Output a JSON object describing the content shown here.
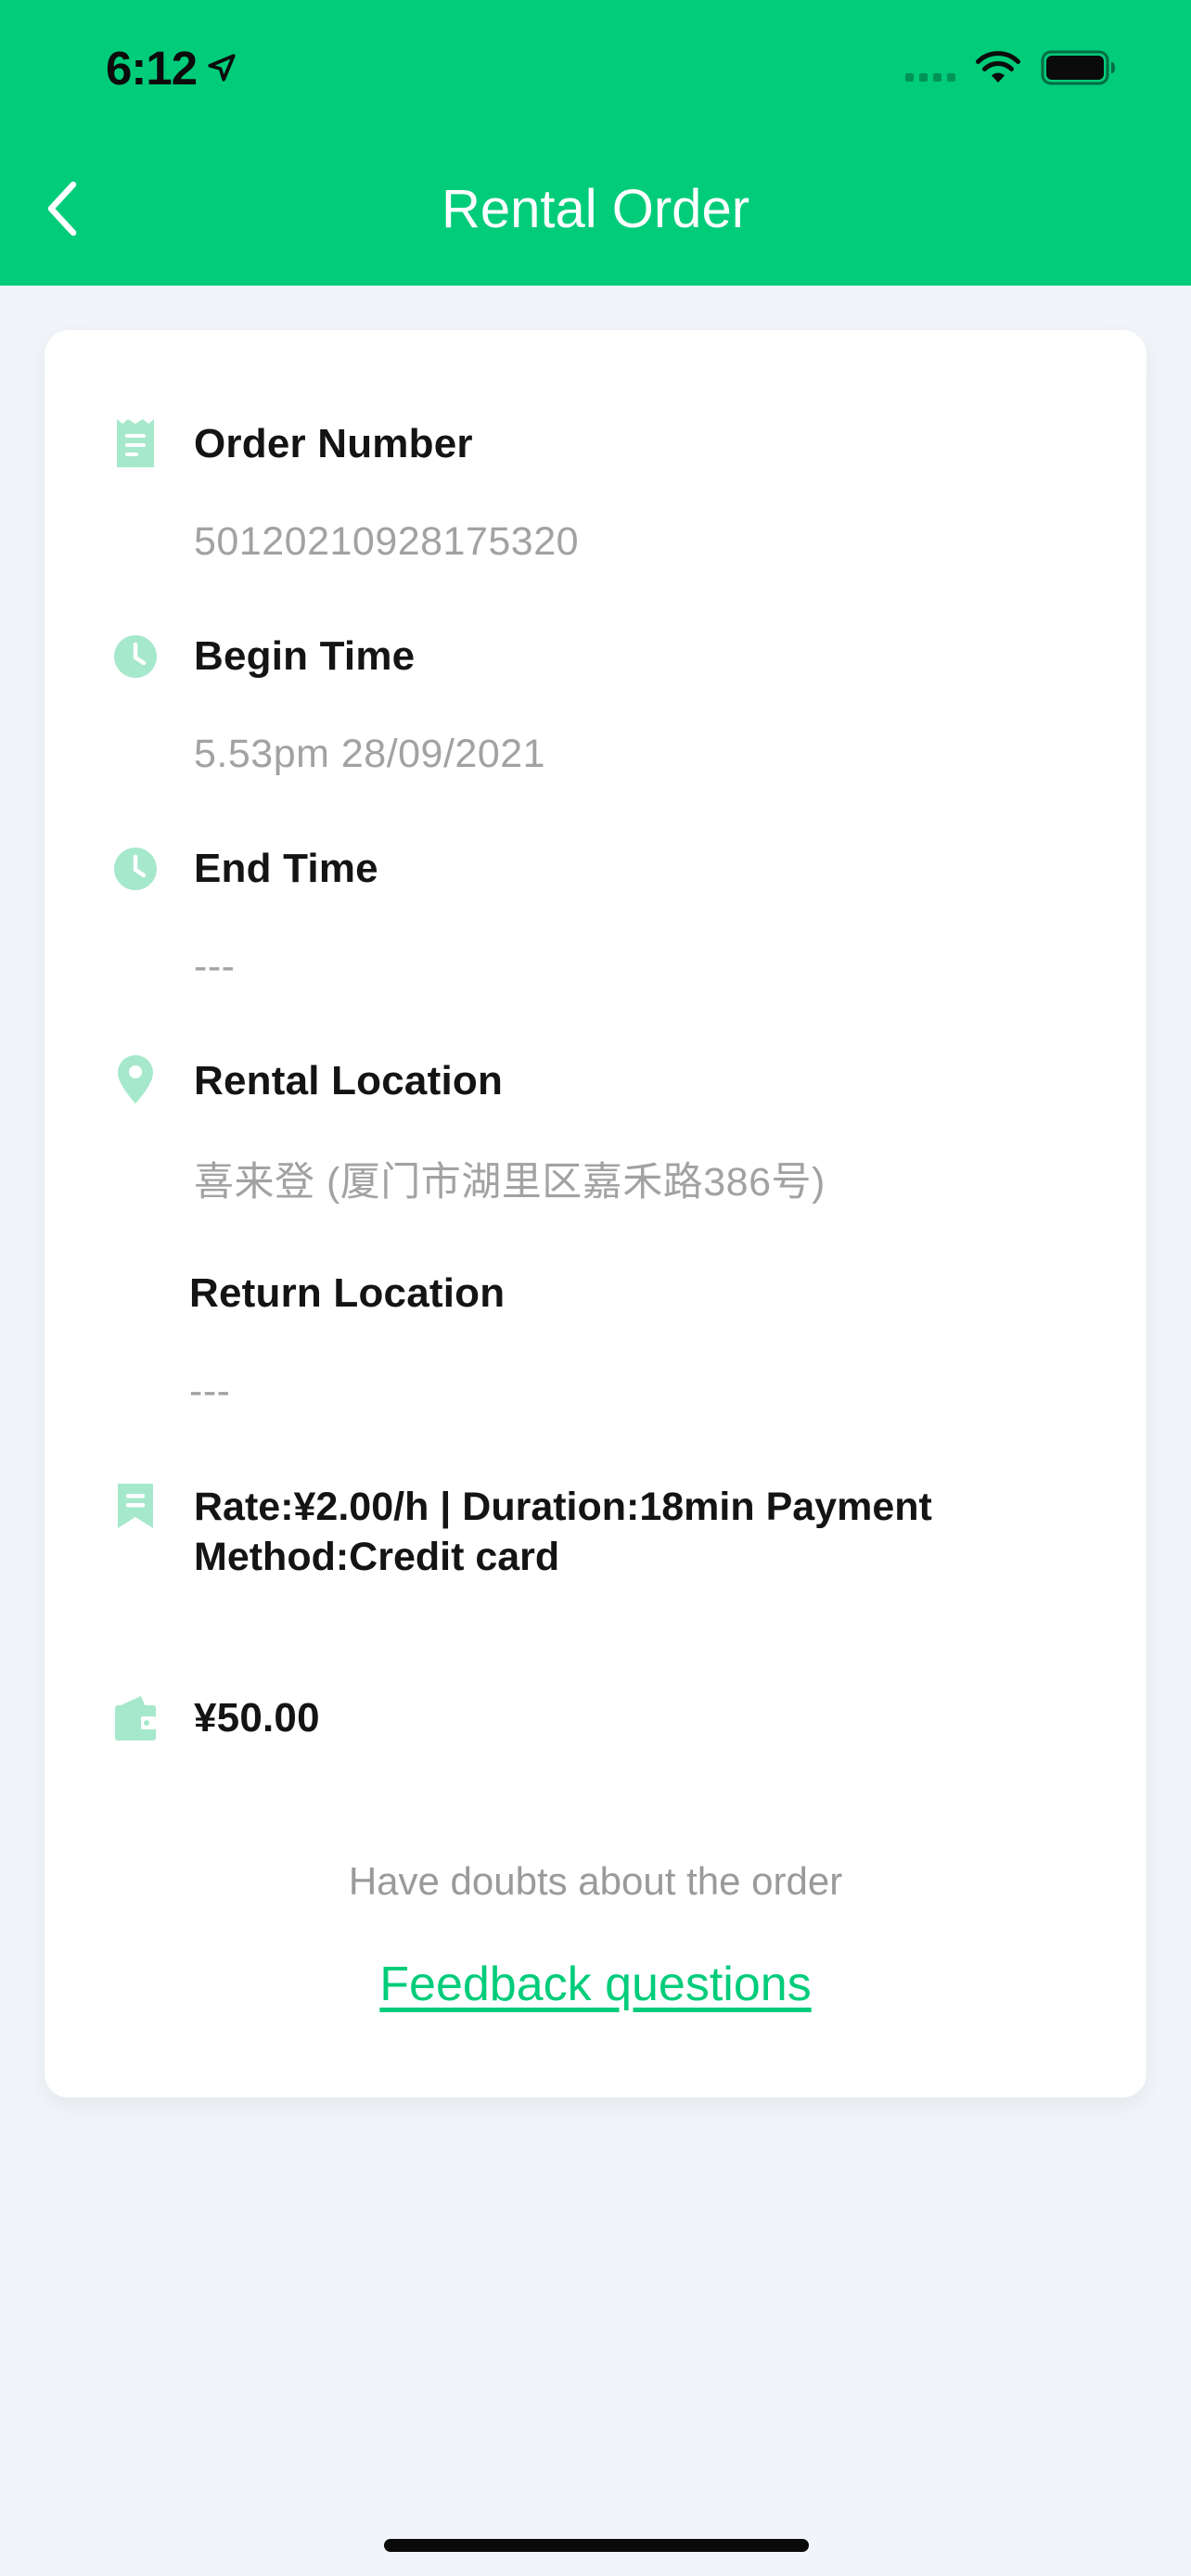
{
  "status_bar": {
    "time": "6:12"
  },
  "nav": {
    "title": "Rental Order"
  },
  "order": {
    "order_number_label": "Order Number",
    "order_number_value": "50120210928175320",
    "begin_time_label": "Begin Time",
    "begin_time_value": "5.53pm 28/09/2021",
    "end_time_label": "End Time",
    "end_time_value": "---",
    "rental_location_label": "Rental Location",
    "rental_location_value": "喜来登 (厦门市湖里区嘉禾路386号)",
    "return_location_label": "Return Location",
    "return_location_value": "---",
    "rate_info": "Rate:¥2.00/h | Duration:18min Payment Method:Credit card",
    "amount": "¥50.00"
  },
  "footer": {
    "doubt_text": "Have doubts about the order",
    "feedback_link": "Feedback questions"
  },
  "icons": {
    "receipt": "receipt-icon",
    "clock": "clock-icon",
    "location": "location-pin-icon",
    "bookmark": "bookmark-icon",
    "wallet": "wallet-icon",
    "back": "chevron-left-icon"
  },
  "colors": {
    "accent": "#00cc7a",
    "icon_tint": "#a6e8cb",
    "background": "#f1f4f8",
    "label_text": "#141414",
    "muted_text": "#a2a2a2"
  }
}
